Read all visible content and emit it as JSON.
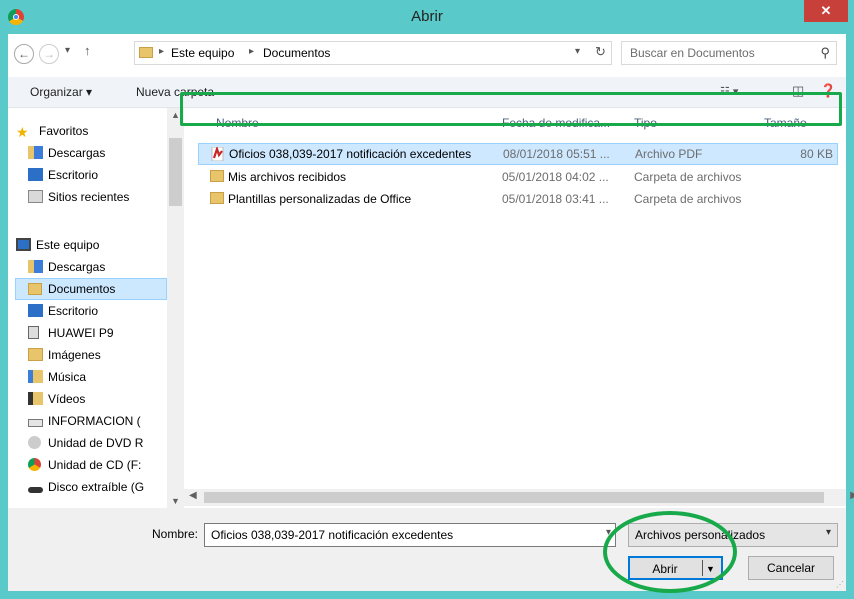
{
  "window": {
    "title": "Abrir",
    "close_label": "✕"
  },
  "address": {
    "crumbs": [
      "Este equipo",
      "Documentos"
    ],
    "search_placeholder": "Buscar en Documentos"
  },
  "toolbar": {
    "organize": "Organizar ▾",
    "new_folder": "Nueva carpeta"
  },
  "nav": {
    "favorites_title": "Favoritos",
    "favorites": [
      "Descargas",
      "Escritorio",
      "Sitios recientes"
    ],
    "pc_title": "Este equipo",
    "pc_items": [
      "Descargas",
      "Documentos",
      "Escritorio",
      "HUAWEI P9",
      "Imágenes",
      "Música",
      "Vídeos",
      "INFORMACION (",
      "Unidad de DVD R",
      "Unidad de CD (F:",
      "Disco extraíble (G"
    ],
    "selected": "Documentos"
  },
  "columns": {
    "name": "Nombre",
    "date": "Fecha de modifica...",
    "type": "Tipo",
    "size": "Tamaño"
  },
  "files": [
    {
      "name": "Oficios 038,039-2017 notificación excedentes",
      "date": "08/01/2018 05:51 ...",
      "type": "Archivo PDF",
      "size": "80 KB",
      "icon": "pdf-icon"
    },
    {
      "name": "Mis archivos recibidos",
      "date": "05/01/2018 04:02 ...",
      "type": "Carpeta de archivos",
      "size": "",
      "icon": "folder-icon"
    },
    {
      "name": "Plantillas personalizadas de Office",
      "date": "05/01/2018 03:41 ...",
      "type": "Carpeta de archivos",
      "size": "",
      "icon": "folder-icon"
    }
  ],
  "bottom": {
    "name_label": "Nombre:",
    "name_value": "Oficios 038,039-2017 notificación excedentes",
    "filter": "Archivos personalizados",
    "open": "Abrir",
    "cancel": "Cancelar"
  },
  "colors": {
    "frame": "#5ac9c9",
    "close": "#c7403a",
    "selection": "#cde8ff",
    "annotation": "#17a94a"
  }
}
